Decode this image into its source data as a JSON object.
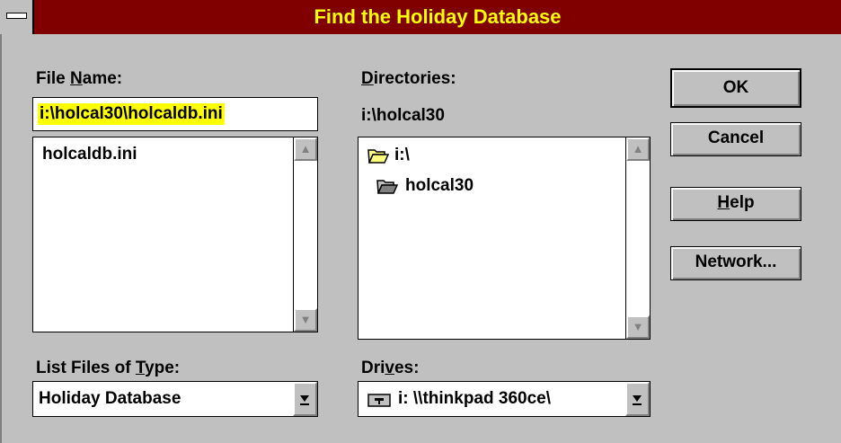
{
  "window": {
    "title": "Find the Holiday Database"
  },
  "file_name": {
    "label_pre": "File ",
    "label_accel": "N",
    "label_post": "ame:",
    "value": "i:\\holcal30\\holcaldb.ini",
    "files": [
      "holcaldb.ini"
    ]
  },
  "directories": {
    "label_accel": "D",
    "label_post": "irectories:",
    "current": "i:\\holcal30",
    "items": [
      "i:\\",
      "holcal30"
    ]
  },
  "list_type": {
    "label_pre": "List Files of ",
    "label_accel": "T",
    "label_post": "ype:",
    "selected": "Holiday Database"
  },
  "drives": {
    "label_pre": "Dri",
    "label_accel": "v",
    "label_post": "es:",
    "selected": "i: \\\\thinkpad 360ce\\"
  },
  "buttons": {
    "ok": "OK",
    "cancel": "Cancel",
    "help_accel": "H",
    "help_post": "elp",
    "network": "Network..."
  }
}
